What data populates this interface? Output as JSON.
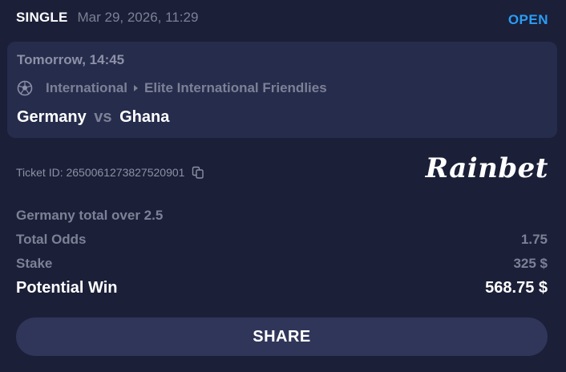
{
  "header": {
    "bet_type": "SINGLE",
    "date": "Mar 29, 2026, 11:29",
    "status": "OPEN",
    "status_color": "#2a9df4"
  },
  "event": {
    "time": "Tomorrow, 14:45",
    "sport_icon": "soccer-ball-icon",
    "category": "International",
    "league": "Elite International Friendlies",
    "home_team": "Germany",
    "vs": "vs",
    "away_team": "Ghana"
  },
  "ticket": {
    "label": "Ticket ID: 2650061273827520901",
    "copy_icon": "copy-icon"
  },
  "brand": {
    "name": "Rainbet"
  },
  "details": {
    "selection": "Germany total over 2.5",
    "odds_label": "Total Odds",
    "odds_value": "1.75",
    "stake_label": "Stake",
    "stake_value": "325 $",
    "win_label": "Potential Win",
    "win_value": "568.75 $"
  },
  "actions": {
    "share_label": "SHARE"
  },
  "colors": {
    "background": "#1b1f38",
    "panel": "#262c4c",
    "button": "#30365a",
    "muted_text": "#7c8196",
    "accent": "#2a9df4"
  }
}
